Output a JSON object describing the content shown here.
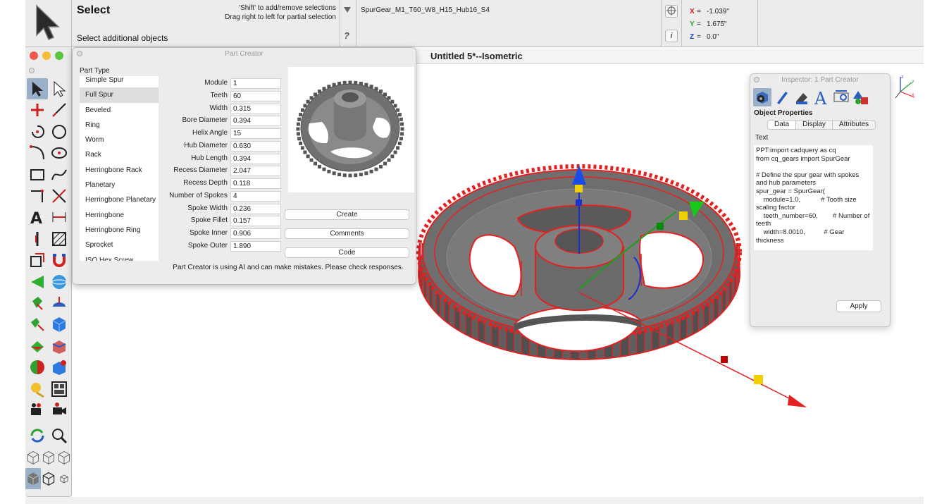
{
  "toolbar": {
    "mode_title": "Select",
    "mode_subtitle": "Select additional objects",
    "hint_line1": "'Shift' to add/remove selections",
    "hint_line2": "Drag right to left for partial selection",
    "help_glyph": "?",
    "object_name": "SpurGear_M1_T60_W8_H15_Hub16_S4",
    "info_glyph": "i",
    "coords": [
      {
        "axis": "X",
        "value": "-1.039\"",
        "color": "#d42020"
      },
      {
        "axis": "Y",
        "value": "1.675\"",
        "color": "#2a9a2a"
      },
      {
        "axis": "Z",
        "value": "0.0\"",
        "color": "#2040d0"
      }
    ]
  },
  "window": {
    "title": "Untitled 5*--Isometric"
  },
  "part_creator": {
    "title": "Part Creator",
    "part_type_label": "Part Type",
    "part_types": [
      "Simple Spur",
      "Full Spur",
      "Beveled",
      "Ring",
      "Worm",
      "Rack",
      "Herringbone Rack",
      "Planetary",
      "Herringbone Planetary",
      "Herringbone",
      "Herringbone Ring",
      "Sprocket",
      "ISO Hex Screw"
    ],
    "selected_index": 1,
    "params": [
      {
        "label": "Module",
        "value": "1"
      },
      {
        "label": "Teeth",
        "value": "60"
      },
      {
        "label": "Width",
        "value": "0.315"
      },
      {
        "label": "Bore Diameter",
        "value": "0.394"
      },
      {
        "label": "Helix Angle",
        "value": "15"
      },
      {
        "label": "Hub Diameter",
        "value": "0.630"
      },
      {
        "label": "Hub Length",
        "value": "0.394"
      },
      {
        "label": "Recess Diameter",
        "value": "2.047"
      },
      {
        "label": "Recess Depth",
        "value": "0.118"
      },
      {
        "label": "Number of Spokes",
        "value": "4"
      },
      {
        "label": "Spoke Width",
        "value": "0.236"
      },
      {
        "label": "Spoke Fillet",
        "value": "0.157"
      },
      {
        "label": "Spoke Inner",
        "value": "0.906"
      },
      {
        "label": "Spoke Outer",
        "value": "1.890"
      }
    ],
    "buttons": {
      "create": "Create",
      "comments": "Comments",
      "code": "Code"
    },
    "note": "Part Creator is using AI and can make mistakes. Please check responses."
  },
  "inspector": {
    "title": "Inspector:  1 Part Creator",
    "section": "Object Properties",
    "tabs": [
      "Data",
      "Display",
      "Attributes"
    ],
    "active_tab": "Data",
    "text_label": "Text",
    "text": "PPT:import cadquery as cq\nfrom cq_gears import SpurGear\n\n# Define the spur gear with spokes and hub parameters\nspur_gear = SpurGear(\n    module=1.0,           # Tooth size scaling factor\n    teeth_number=60,        # Number of teeth\n    width=8.0010,          # Gear thickness",
    "apply_label": "Apply",
    "icons": [
      "object-info-icon",
      "pen-icon",
      "fill-icon",
      "text-style-icon",
      "dimension-icon",
      "render-icon"
    ]
  },
  "palette": {
    "icons": [
      "select-arrow-icon",
      "hollow-arrow-icon",
      "point-icon",
      "line-icon",
      "arc-center-icon",
      "circle-icon",
      "fillet-arc-icon",
      "ellipse-icon",
      "rectangle-icon",
      "spline-icon",
      "corner-icon",
      "trim-icon",
      "text-icon",
      "dimension-icon",
      "vertical-line-icon",
      "hatch-icon",
      "transform-icon",
      "magnet-icon",
      "solid-cone-icon",
      "sphere-icon",
      "extrude-icon",
      "revolve-icon",
      "sweep-icon",
      "cube-icon",
      "boolean-icon",
      "shell-icon",
      "fillet-solid-icon",
      "solid-edit-icon",
      "light-icon",
      "layout-icon",
      "camera-icon",
      "video-camera-icon",
      "rotate-view-icon",
      "zoom-icon",
      "wire-iso-icon",
      "wire-iso-2-icon",
      "wire-iso-3-icon",
      "shaded-cube-icon",
      "outline-cube-icon",
      "small-cube-icon"
    ]
  },
  "colors": {
    "selection_red": "#e52020",
    "gear_gray": "#6e6e6e",
    "axis_x": "#e52020",
    "axis_y": "#1aa01a",
    "axis_z": "#1a30d0"
  }
}
